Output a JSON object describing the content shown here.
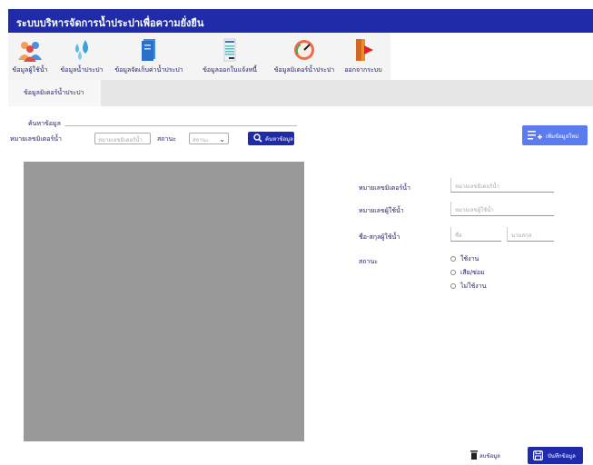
{
  "app": {
    "title": "ระบบบริหารจัดการน้ำประปาเพื่อความยั่งยืน"
  },
  "nav": {
    "items": [
      {
        "label": "ข้อมูลผู้ใช้น้ำ",
        "icon": "people-icon"
      },
      {
        "label": "ข้อมูลน้ำประปา",
        "icon": "water-drops-icon"
      },
      {
        "label": "ข้อมูลจัดเก็บค่าน้ำประปา",
        "icon": "document-icon"
      },
      {
        "label": "ข้อมูลออกใบแจ้งหนี้",
        "icon": "invoice-icon"
      },
      {
        "label": "ข้อมูลมิเตอร์น้ำประปา",
        "icon": "meter-gauge-icon"
      },
      {
        "label": "ออกจากระบบ",
        "icon": "exit-door-icon"
      }
    ]
  },
  "tabs": {
    "active": "ข้อมูลมิเตอร์น้ำประปา"
  },
  "search": {
    "legend": "ค้นหาข้อมูล",
    "meter_label": "หมายเลขมิเตอร์น้ำ",
    "meter_placeholder": "หมายเลขมิเตอร์น้ำ",
    "status_label": "สถานะ",
    "status_placeholder": "สถานะ",
    "search_button": "ค้นหาข้อมูล"
  },
  "add_button": "เพิ่มข้อมูลใหม่",
  "form": {
    "meter_label": "หมายเลขมิเตอร์น้ำ",
    "meter_placeholder": "หมายเลขมิเตอร์น้ำ",
    "user_no_label": "หมายเลขผู้ใช้น้ำ",
    "user_no_placeholder": "หมายเลขผู้ใช้น้ำ",
    "name_label": "ชื่อ-สกุลผู้ใช้น้ำ",
    "first_placeholder": "ชื่อ",
    "last_placeholder": "นามสกุล",
    "status_label": "สถานะ",
    "status_options": [
      "ใช้งาน",
      "เสีย/ซ่อม",
      "ไม่ใช้งาน"
    ]
  },
  "actions": {
    "delete": "ลบข้อมูล",
    "save": "บันทึกข้อมูล"
  },
  "colors": {
    "primary": "#1f2ba8",
    "accent": "#5a7cf0",
    "panel": "#999999"
  }
}
